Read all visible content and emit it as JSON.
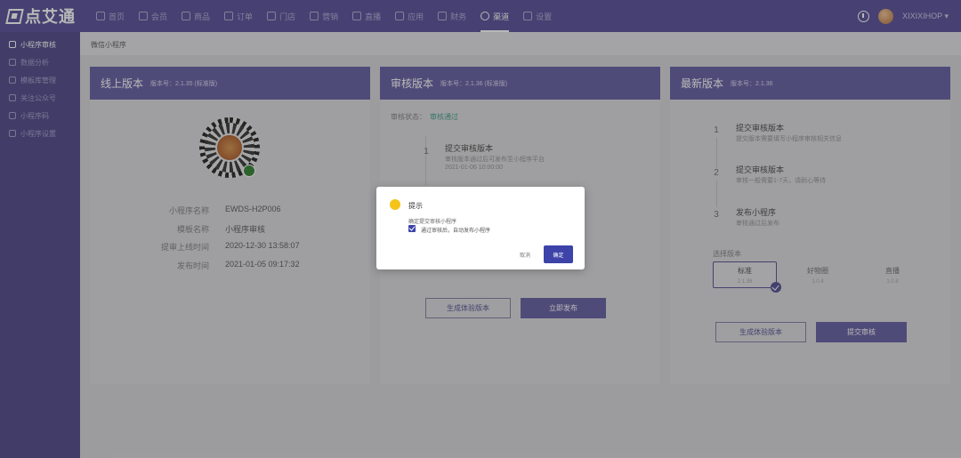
{
  "app": {
    "logo_text": "点艾通"
  },
  "nav": {
    "items": [
      {
        "label": "首页",
        "icon": "home-icon"
      },
      {
        "label": "会员",
        "icon": "member-icon"
      },
      {
        "label": "商品",
        "icon": "goods-icon"
      },
      {
        "label": "订单",
        "icon": "order-icon"
      },
      {
        "label": "门店",
        "icon": "store-icon"
      },
      {
        "label": "营销",
        "icon": "marketing-icon"
      },
      {
        "label": "直播",
        "icon": "live-icon"
      },
      {
        "label": "应用",
        "icon": "apps-icon"
      },
      {
        "label": "财务",
        "icon": "finance-icon"
      },
      {
        "label": "渠道",
        "icon": "channel-icon",
        "active": true
      },
      {
        "label": "设置",
        "icon": "settings-icon"
      }
    ],
    "user_name": "XIXIXIHOP ▾"
  },
  "sidebar": {
    "items": [
      {
        "label": "小程序审核",
        "active": true
      },
      {
        "label": "数据分析"
      },
      {
        "label": "模板库管理"
      },
      {
        "label": "关注公众号"
      },
      {
        "label": "小程序码"
      },
      {
        "label": "小程序设置"
      }
    ]
  },
  "breadcrumb": "微信小程序",
  "online": {
    "title": "线上版本",
    "version_label": "版本号：2.1.35 (标准版)",
    "rows": [
      {
        "key": "小程序名称",
        "value": "EWDS-H2P006"
      },
      {
        "key": "模板名称",
        "value": "小程序审核"
      },
      {
        "key": "提审上线时间",
        "value": "2020-12-30 13:58:07"
      },
      {
        "key": "发布时间",
        "value": "2021-01-05 09:17:32"
      }
    ]
  },
  "audit": {
    "title": "审核版本",
    "version_label": "版本号：2.1.36 (标准版)",
    "status_label": "审核状态：",
    "status_value": "审核通过",
    "step": {
      "num": "1",
      "title": "提交审核版本",
      "desc": "审核版本通过后可发布至小程序平台",
      "time": "2021-01-06 10:00:00"
    },
    "btn_experience": "生成体验版本",
    "btn_publish": "立即发布"
  },
  "latest": {
    "title": "最新版本",
    "version_label": "版本号：2.1.36",
    "steps": [
      {
        "num": "1",
        "title": "提交审核版本",
        "desc": "提交版本需要填写小程序审核相关信息"
      },
      {
        "num": "2",
        "title": "提交审核版本",
        "desc": "审核一般需要1-7天，请耐心等待"
      },
      {
        "num": "3",
        "title": "发布小程序",
        "desc": "审核通过后发布"
      }
    ],
    "select_label": "选择版本",
    "options": [
      {
        "name": "标准",
        "sub": "2.1.36",
        "selected": true
      },
      {
        "name": "好物圈",
        "sub": "1.0.4"
      },
      {
        "name": "直播",
        "sub": "1.0.8"
      }
    ],
    "btn_experience": "生成体验版本",
    "btn_submit": "提交审核"
  },
  "dialog": {
    "title": "提示",
    "message": "确定提交审核小程序",
    "checkbox_label": "通过审核后，自动发布小程序",
    "cancel": "取消",
    "ok": "确定",
    "icon_color": "#f5c418"
  }
}
